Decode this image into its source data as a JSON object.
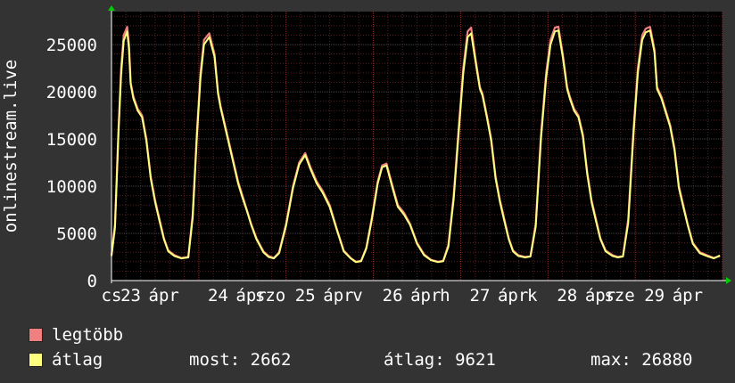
{
  "chart_data": {
    "type": "line",
    "ylabel": "onlinestream.live",
    "ylim": [
      0,
      28500
    ],
    "yticks": [
      0,
      5000,
      10000,
      15000,
      20000,
      25000
    ],
    "x_range": [
      0,
      7
    ],
    "x_tick_labels": [
      {
        "x": 0,
        "label": "cs"
      },
      {
        "x": 0.22,
        "label": "23"
      },
      {
        "x": 0.6,
        "label": "ápr"
      },
      {
        "x": 1.22,
        "label": "24"
      },
      {
        "x": 1.6,
        "label": "ápr"
      },
      {
        "x": 1.82,
        "label": "szo"
      },
      {
        "x": 2.22,
        "label": "25"
      },
      {
        "x": 2.6,
        "label": "ápr"
      },
      {
        "x": 2.82,
        "label": "v"
      },
      {
        "x": 3.22,
        "label": "26"
      },
      {
        "x": 3.6,
        "label": "ápr"
      },
      {
        "x": 3.82,
        "label": "h"
      },
      {
        "x": 4.22,
        "label": "27"
      },
      {
        "x": 4.6,
        "label": "ápr"
      },
      {
        "x": 4.82,
        "label": "k"
      },
      {
        "x": 5.22,
        "label": "28"
      },
      {
        "x": 5.6,
        "label": "ápr"
      },
      {
        "x": 5.82,
        "label": "sze"
      },
      {
        "x": 6.22,
        "label": "29"
      },
      {
        "x": 6.6,
        "label": "ápr"
      }
    ],
    "series": [
      {
        "name": "legtöbb",
        "color": "#f08080",
        "x": [
          0,
          0.04,
          0.08,
          0.11,
          0.14,
          0.18,
          0.2,
          0.22,
          0.25,
          0.3,
          0.35,
          0.4,
          0.45,
          0.5,
          0.55,
          0.6,
          0.65,
          0.72,
          0.8,
          0.88,
          0.93,
          0.98,
          1.02,
          1.06,
          1.12,
          1.18,
          1.22,
          1.25,
          1.3,
          1.35,
          1.4,
          1.45,
          1.5,
          1.55,
          1.6,
          1.66,
          1.74,
          1.8,
          1.86,
          1.92,
          2.0,
          2.08,
          2.15,
          2.22,
          2.28,
          2.35,
          2.42,
          2.5,
          2.58,
          2.66,
          2.74,
          2.8,
          2.86,
          2.92,
          2.98,
          3.05,
          3.1,
          3.15,
          3.22,
          3.28,
          3.35,
          3.42,
          3.5,
          3.58,
          3.66,
          3.74,
          3.8,
          3.86,
          3.92,
          3.98,
          4.03,
          4.08,
          4.12,
          4.17,
          4.22,
          4.25,
          4.3,
          4.35,
          4.4,
          4.45,
          4.5,
          4.55,
          4.6,
          4.66,
          4.74,
          4.8,
          4.86,
          4.92,
          4.98,
          5.03,
          5.08,
          5.12,
          5.17,
          5.22,
          5.25,
          5.3,
          5.35,
          5.4,
          5.45,
          5.5,
          5.55,
          5.6,
          5.66,
          5.74,
          5.8,
          5.86,
          5.92,
          5.98,
          6.03,
          6.08,
          6.12,
          6.17,
          6.22,
          6.25,
          6.3,
          6.35,
          6.4,
          6.45,
          6.5,
          6.55,
          6.6,
          6.66,
          6.74,
          6.82,
          6.9,
          6.97
        ],
        "values": [
          2700,
          6000,
          16000,
          22500,
          26000,
          26880,
          25000,
          21000,
          19500,
          18200,
          17500,
          15000,
          11000,
          8500,
          6500,
          4500,
          3200,
          2700,
          2400,
          2500,
          7000,
          16000,
          22000,
          25500,
          26200,
          24000,
          20000,
          18500,
          16500,
          14500,
          12500,
          10500,
          9000,
          7500,
          6000,
          4500,
          3100,
          2600,
          2400,
          3000,
          6000,
          10000,
          12500,
          13500,
          12000,
          10500,
          9500,
          8000,
          5500,
          3200,
          2400,
          2000,
          2100,
          3500,
          6500,
          10500,
          12200,
          12400,
          10000,
          8000,
          7200,
          6000,
          4000,
          2800,
          2200,
          2000,
          2100,
          3800,
          9000,
          16500,
          22500,
          26400,
          26800,
          23500,
          20500,
          19800,
          17500,
          15000,
          11000,
          8500,
          6500,
          4500,
          3200,
          2700,
          2500,
          2600,
          6000,
          15500,
          22000,
          25500,
          26800,
          26900,
          24000,
          20500,
          19500,
          18200,
          17500,
          15500,
          11500,
          8500,
          6500,
          4500,
          3200,
          2700,
          2500,
          2600,
          6500,
          16000,
          22500,
          26000,
          26700,
          26880,
          24500,
          20500,
          19500,
          18000,
          16500,
          14000,
          10000,
          8000,
          6000,
          4000,
          3000,
          2700,
          2400,
          2600
        ]
      },
      {
        "name": "átlag",
        "color": "#ffff80",
        "x": [
          0,
          0.04,
          0.08,
          0.11,
          0.14,
          0.18,
          0.2,
          0.22,
          0.25,
          0.3,
          0.35,
          0.4,
          0.45,
          0.5,
          0.55,
          0.6,
          0.65,
          0.72,
          0.8,
          0.88,
          0.93,
          0.98,
          1.02,
          1.06,
          1.12,
          1.18,
          1.22,
          1.25,
          1.3,
          1.35,
          1.4,
          1.45,
          1.5,
          1.55,
          1.6,
          1.66,
          1.74,
          1.8,
          1.86,
          1.92,
          2.0,
          2.08,
          2.15,
          2.22,
          2.28,
          2.35,
          2.42,
          2.5,
          2.58,
          2.66,
          2.74,
          2.8,
          2.86,
          2.92,
          2.98,
          3.05,
          3.1,
          3.15,
          3.22,
          3.28,
          3.35,
          3.42,
          3.5,
          3.58,
          3.66,
          3.74,
          3.8,
          3.86,
          3.92,
          3.98,
          4.03,
          4.08,
          4.12,
          4.17,
          4.22,
          4.25,
          4.3,
          4.35,
          4.4,
          4.45,
          4.5,
          4.55,
          4.6,
          4.66,
          4.74,
          4.8,
          4.86,
          4.92,
          4.98,
          5.03,
          5.08,
          5.12,
          5.17,
          5.22,
          5.25,
          5.3,
          5.35,
          5.4,
          5.45,
          5.5,
          5.55,
          5.6,
          5.66,
          5.74,
          5.8,
          5.86,
          5.92,
          5.98,
          6.03,
          6.08,
          6.12,
          6.17,
          6.22,
          6.25,
          6.3,
          6.35,
          6.4,
          6.45,
          6.5,
          6.55,
          6.6,
          6.66,
          6.74,
          6.82,
          6.9,
          6.97
        ],
        "values": [
          2600,
          5600,
          15500,
          21800,
          25400,
          26400,
          24500,
          20800,
          19300,
          18000,
          17300,
          14800,
          10800,
          8300,
          6300,
          4400,
          3100,
          2600,
          2350,
          2450,
          6600,
          15500,
          21500,
          25000,
          25800,
          23700,
          19800,
          18300,
          16300,
          14300,
          12300,
          10300,
          8800,
          7400,
          5900,
          4400,
          3000,
          2500,
          2350,
          2900,
          5800,
          9800,
          12300,
          13300,
          11800,
          10300,
          9300,
          7800,
          5400,
          3100,
          2350,
          1950,
          2050,
          3400,
          6300,
          10300,
          12000,
          12200,
          9800,
          7800,
          7000,
          5900,
          3900,
          2700,
          2150,
          1950,
          2050,
          3600,
          8600,
          16000,
          22000,
          25800,
          26200,
          23200,
          20300,
          19600,
          17300,
          14800,
          10800,
          8300,
          6300,
          4400,
          3100,
          2600,
          2450,
          2550,
          5700,
          15000,
          21500,
          25000,
          26400,
          26500,
          23700,
          20300,
          19300,
          18000,
          17300,
          15300,
          11300,
          8300,
          6300,
          4400,
          3100,
          2600,
          2450,
          2550,
          6100,
          15500,
          22000,
          25500,
          26300,
          26500,
          24200,
          20300,
          19300,
          17800,
          16300,
          13800,
          9800,
          7800,
          5900,
          3900,
          2900,
          2600,
          2350,
          2662
        ]
      }
    ]
  },
  "legend": {
    "items": [
      {
        "label": "legtöbb",
        "color": "#f08080"
      },
      {
        "label": "átlag",
        "color": "#ffff80"
      }
    ],
    "stats": {
      "now": "most: 2662",
      "avg": "átlag: 9621",
      "max": "max: 26880"
    }
  }
}
